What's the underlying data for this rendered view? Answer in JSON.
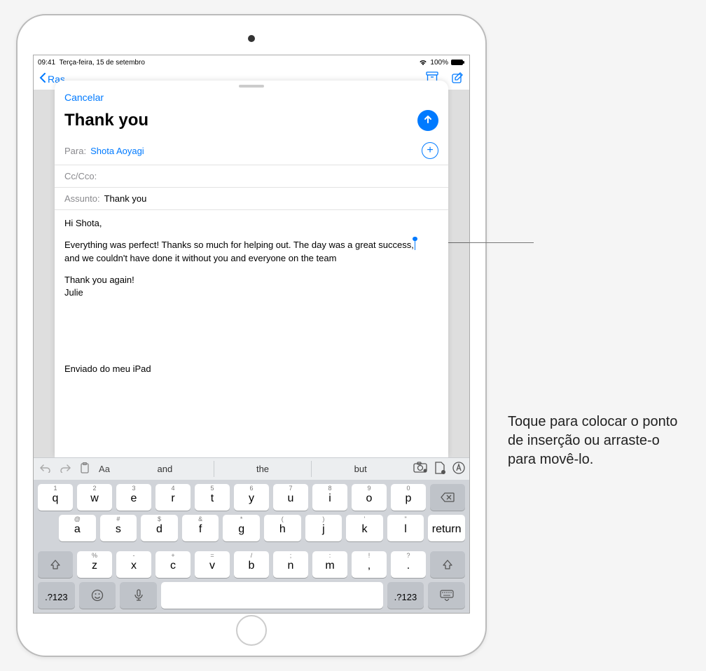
{
  "status": {
    "time": "09:41",
    "date": "Terça-feira, 15 de setembro",
    "battery_pct": "100%"
  },
  "navbar": {
    "back_label": "Ras"
  },
  "compose": {
    "cancel": "Cancelar",
    "subject_title": "Thank you",
    "to_label": "Para:",
    "to_value": "Shota Aoyagi",
    "cc_label": "Cc/Cco:",
    "subject_label": "Assunto:",
    "subject_value": "Thank you",
    "body_greeting": "Hi Shota,",
    "body_p1a": "Everything was perfect! Thanks so much for helping out. The day was a great success,",
    "body_p1b": " and we couldn't have done it without you and everyone on the team",
    "body_thanks": "Thank you again!",
    "body_sign": "Julie",
    "signature": "Enviado do meu iPad"
  },
  "toolbar": {
    "format_label": "Aa",
    "suggestions": [
      "and",
      "the",
      "but"
    ]
  },
  "keyboard": {
    "row1": [
      {
        "alt": "1",
        "main": "q"
      },
      {
        "alt": "2",
        "main": "w"
      },
      {
        "alt": "3",
        "main": "e"
      },
      {
        "alt": "4",
        "main": "r"
      },
      {
        "alt": "5",
        "main": "t"
      },
      {
        "alt": "6",
        "main": "y"
      },
      {
        "alt": "7",
        "main": "u"
      },
      {
        "alt": "8",
        "main": "i"
      },
      {
        "alt": "9",
        "main": "o"
      },
      {
        "alt": "0",
        "main": "p"
      }
    ],
    "row2": [
      {
        "alt": "@",
        "main": "a"
      },
      {
        "alt": "#",
        "main": "s"
      },
      {
        "alt": "$",
        "main": "d"
      },
      {
        "alt": "&",
        "main": "f"
      },
      {
        "alt": "*",
        "main": "g"
      },
      {
        "alt": "(",
        "main": "h"
      },
      {
        "alt": ")",
        "main": "j"
      },
      {
        "alt": "'",
        "main": "k"
      },
      {
        "alt": "\"",
        "main": "l"
      }
    ],
    "row2_return": "return",
    "row3": [
      {
        "alt": "%",
        "main": "z"
      },
      {
        "alt": "-",
        "main": "x"
      },
      {
        "alt": "+",
        "main": "c"
      },
      {
        "alt": "=",
        "main": "v"
      },
      {
        "alt": "/",
        "main": "b"
      },
      {
        "alt": ";",
        "main": "n"
      },
      {
        "alt": ":",
        "main": "m"
      },
      {
        "alt": "!",
        "main": ","
      },
      {
        "alt": "?",
        "main": "."
      }
    ],
    "row4_numkey": ".?123"
  },
  "callout": {
    "text": "Toque para colocar o ponto de inserção ou arraste-o para movê-lo."
  }
}
